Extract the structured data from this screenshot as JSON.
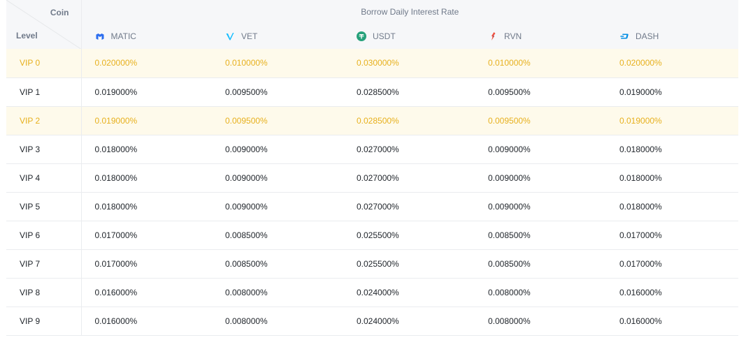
{
  "header": {
    "corner_coin": "Coin",
    "corner_level": "Level",
    "group_title": "Borrow Daily Interest Rate",
    "coins": [
      {
        "label": "MATIC",
        "icon": "matic-icon",
        "color": "#2b6def"
      },
      {
        "label": "VET",
        "icon": "vet-icon",
        "color": "#15bdff"
      },
      {
        "label": "USDT",
        "icon": "usdt-icon",
        "color": "#26a17b"
      },
      {
        "label": "RVN",
        "icon": "rvn-icon",
        "color": "#f0513f"
      },
      {
        "label": "DASH",
        "icon": "dash-icon",
        "color": "#008de4"
      }
    ]
  },
  "colors": {
    "highlight_bg": "#fefaeb",
    "highlight_text": "#e7b01d",
    "header_bg": "#f6f7f9",
    "muted_text": "#707a8a"
  },
  "rows": [
    {
      "level": "VIP 0",
      "highlight": true,
      "values": [
        "0.020000%",
        "0.010000%",
        "0.030000%",
        "0.010000%",
        "0.020000%"
      ]
    },
    {
      "level": "VIP 1",
      "highlight": false,
      "values": [
        "0.019000%",
        "0.009500%",
        "0.028500%",
        "0.009500%",
        "0.019000%"
      ]
    },
    {
      "level": "VIP 2",
      "highlight": true,
      "values": [
        "0.019000%",
        "0.009500%",
        "0.028500%",
        "0.009500%",
        "0.019000%"
      ]
    },
    {
      "level": "VIP 3",
      "highlight": false,
      "values": [
        "0.018000%",
        "0.009000%",
        "0.027000%",
        "0.009000%",
        "0.018000%"
      ]
    },
    {
      "level": "VIP 4",
      "highlight": false,
      "values": [
        "0.018000%",
        "0.009000%",
        "0.027000%",
        "0.009000%",
        "0.018000%"
      ]
    },
    {
      "level": "VIP 5",
      "highlight": false,
      "values": [
        "0.018000%",
        "0.009000%",
        "0.027000%",
        "0.009000%",
        "0.018000%"
      ]
    },
    {
      "level": "VIP 6",
      "highlight": false,
      "values": [
        "0.017000%",
        "0.008500%",
        "0.025500%",
        "0.008500%",
        "0.017000%"
      ]
    },
    {
      "level": "VIP 7",
      "highlight": false,
      "values": [
        "0.017000%",
        "0.008500%",
        "0.025500%",
        "0.008500%",
        "0.017000%"
      ]
    },
    {
      "level": "VIP 8",
      "highlight": false,
      "values": [
        "0.016000%",
        "0.008000%",
        "0.024000%",
        "0.008000%",
        "0.016000%"
      ]
    },
    {
      "level": "VIP 9",
      "highlight": false,
      "values": [
        "0.016000%",
        "0.008000%",
        "0.024000%",
        "0.008000%",
        "0.016000%"
      ]
    }
  ]
}
